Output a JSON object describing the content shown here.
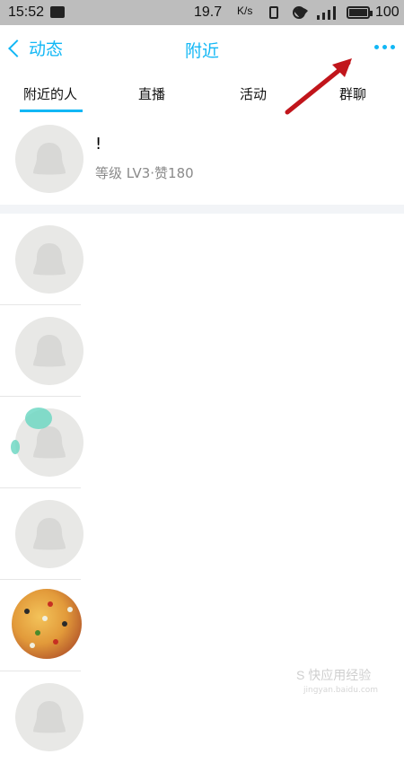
{
  "status_bar": {
    "time": "15:52",
    "speed": "19.7",
    "speed_unit": "K/s",
    "battery": "100"
  },
  "header": {
    "back_label": "动态",
    "title": "附近"
  },
  "tabs": [
    {
      "label": "附近的人",
      "active": true
    },
    {
      "label": "直播",
      "active": false
    },
    {
      "label": "活动",
      "active": false
    },
    {
      "label": "群聊",
      "active": false
    }
  ],
  "first_row": {
    "name": "!",
    "level_text": "等级 LV3·赞180"
  },
  "watermark": {
    "text": "S 快应用经验",
    "sub": "jingyan.baidu.com"
  },
  "colors": {
    "accent": "#12b7f5",
    "annotation_arrow": "#c1151b"
  }
}
